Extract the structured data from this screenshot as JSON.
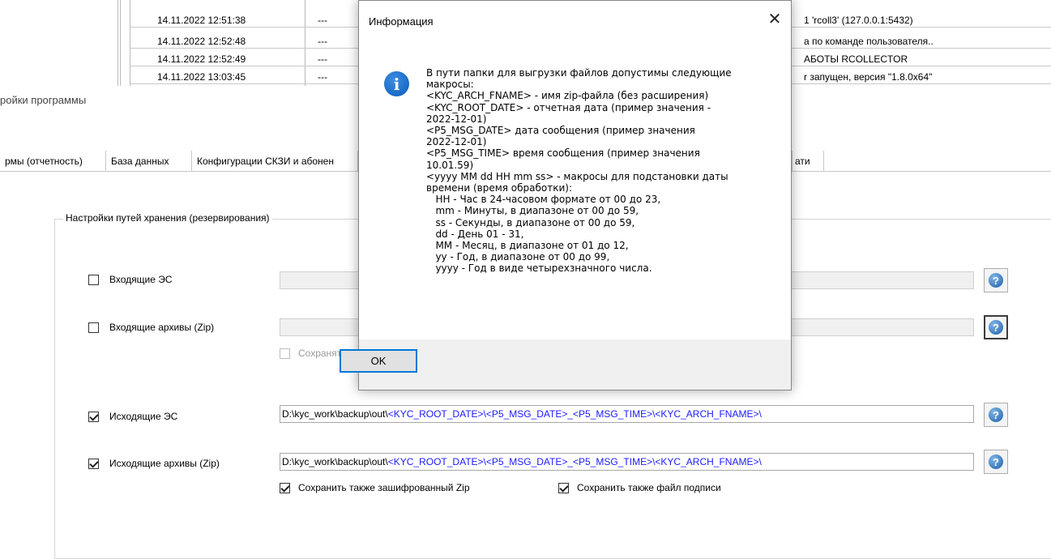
{
  "log": {
    "rows": [
      {
        "ts": "14.11.2022 12:51:38",
        "dash": "---",
        "msg": "1 'rcoll3' (127.0.0.1:5432)"
      },
      {
        "ts": "14.11.2022 12:52:48",
        "dash": "---",
        "msg": "а по команде пользователя.."
      },
      {
        "ts": "14.11.2022 12:52:49",
        "dash": "---",
        "msg": "АБОТЫ RCOLLECTOR"
      },
      {
        "ts": "14.11.2022 13:03:45",
        "dash": "---",
        "msg": "r запущен, версия \"1.8.0x64\""
      }
    ]
  },
  "settings": {
    "title": "ройки программы",
    "tabs": [
      {
        "label": "рмы (отчетность)"
      },
      {
        "label": "База данных"
      },
      {
        "label": "Конфигурации СКЗИ и абонен"
      },
      {
        "label": "ати"
      }
    ],
    "group_title": "Настройки путей хранения (резервирования)",
    "rows": {
      "in_es": {
        "label": "Входящие ЭС",
        "checked": false,
        "value": ""
      },
      "in_zip": {
        "label": "Входящие архивы (Zip)",
        "checked": false,
        "value": ""
      },
      "in_save": {
        "label": "Сохранять"
      },
      "out_es": {
        "label": "Исходящие ЭС",
        "checked": true,
        "path_plain": "D:\\kyc_work\\backup\\out\\",
        "path_macros": "<KYC_ROOT_DATE>\\<P5_MSG_DATE>_<P5_MSG_TIME>\\<KYC_ARCH_FNAME>\\"
      },
      "out_zip": {
        "label": "Исходящие архивы (Zip)",
        "checked": true,
        "path_plain": "D:\\kyc_work\\backup\\out\\",
        "path_macros": "<KYC_ROOT_DATE>\\<P5_MSG_DATE>_<P5_MSG_TIME>\\<KYC_ARCH_FNAME>\\"
      },
      "save_encrypted": {
        "label": "Сохранить также зашифрованный Zip",
        "checked": true
      },
      "save_signature": {
        "label": "Сохранить также файл подписи",
        "checked": true
      }
    },
    "help_glyph": "?"
  },
  "dialog": {
    "title": "Информация",
    "close_glyph": "✕",
    "info_glyph": "i",
    "lines": [
      "В пути папки для выгрузки файлов допустимы следующие",
      "макросы:",
      "<KYC_ARCH_FNAME> - имя zip-файла (без расширения)",
      "<KYC_ROOT_DATE> - отчетная дата (пример значения -",
      "2022-12-01)",
      "<P5_MSG_DATE> дата сообщения (пример значения",
      "2022-12-01)",
      "<P5_MSG_TIME> время сообщения (пример значения",
      "10.01.59)",
      "<yyyy MM dd HH mm ss> - макросы для подстановки даты",
      "времени (время обработки):",
      "   HH - Час в 24-часовом формате от 00 до 23,",
      "   mm - Минуты, в диапазоне от 00 до 59,",
      "   ss - Секунды, в диапазоне от 00 до 59,",
      "   dd - День 01 - 31,",
      "   MM - Месяц, в диапазоне от 01 до 12,",
      "   yy - Год, в диапазоне от 00 до 99,",
      "   yyyy - Год в виде четырехзначного числа."
    ],
    "ok_label": "OK"
  }
}
